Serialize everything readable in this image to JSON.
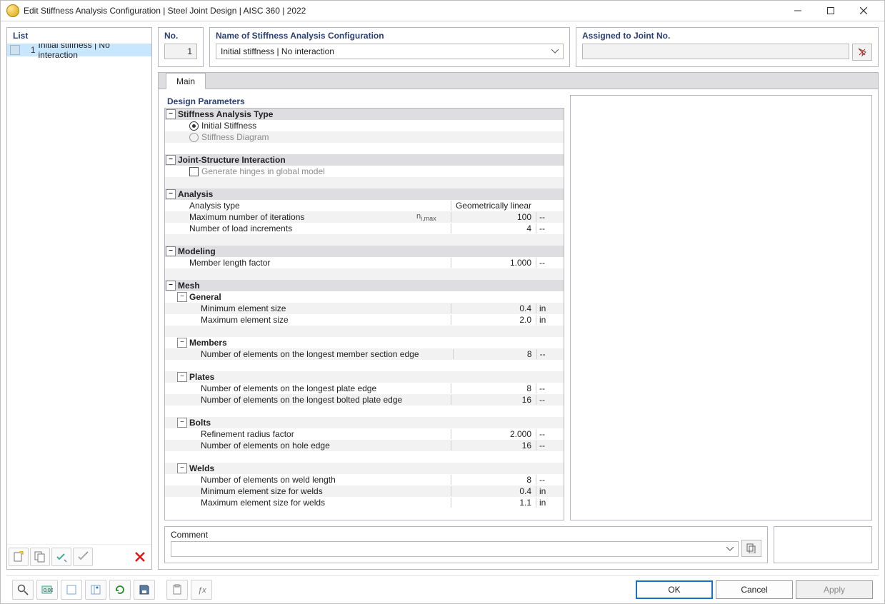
{
  "window": {
    "title": "Edit Stiffness Analysis Configuration | Steel Joint Design | AISC 360 | 2022"
  },
  "list": {
    "header": "List",
    "items": [
      {
        "num": "1",
        "label": "Initial stiffness | No interaction"
      }
    ]
  },
  "no": {
    "label": "No.",
    "value": "1"
  },
  "name": {
    "label": "Name of Stiffness Analysis Configuration",
    "value": "Initial stiffness | No interaction"
  },
  "assigned": {
    "label": "Assigned to Joint No.",
    "value": ""
  },
  "tabs": {
    "main": "Main"
  },
  "sectionTitle": "Design Parameters",
  "groups": {
    "sat": {
      "title": "Stiffness Analysis Type",
      "opt1": "Initial Stiffness",
      "opt2": "Stiffness Diagram"
    },
    "jsi": {
      "title": "Joint-Structure Interaction",
      "check": "Generate hinges in global model"
    },
    "analysis": {
      "title": "Analysis",
      "r1l": "Analysis type",
      "r1v": "Geometrically linear",
      "r2l": "Maximum number of iterations",
      "r2s": "ni,max",
      "r2v": "100",
      "r2u": "--",
      "r3l": "Number of load increments",
      "r3v": "4",
      "r3u": "--"
    },
    "modeling": {
      "title": "Modeling",
      "r1l": "Member length factor",
      "r1v": "1.000",
      "r1u": "--"
    },
    "mesh": {
      "title": "Mesh",
      "general": {
        "title": "General",
        "r1l": "Minimum element size",
        "r1v": "0.4",
        "r1u": "in",
        "r2l": "Maximum element size",
        "r2v": "2.0",
        "r2u": "in"
      },
      "members": {
        "title": "Members",
        "r1l": "Number of elements on the longest member section edge",
        "r1v": "8",
        "r1u": "--"
      },
      "plates": {
        "title": "Plates",
        "r1l": "Number of elements on the longest plate edge",
        "r1v": "8",
        "r1u": "--",
        "r2l": "Number of elements on the longest bolted plate edge",
        "r2v": "16",
        "r2u": "--"
      },
      "bolts": {
        "title": "Bolts",
        "r1l": "Refinement radius factor",
        "r1v": "2.000",
        "r1u": "--",
        "r2l": "Number of elements on hole edge",
        "r2v": "16",
        "r2u": "--"
      },
      "welds": {
        "title": "Welds",
        "r1l": "Number of elements on weld length",
        "r1v": "8",
        "r1u": "--",
        "r2l": "Minimum element size for welds",
        "r2v": "0.4",
        "r2u": "in",
        "r3l": "Maximum element size for welds",
        "r3v": "1.1",
        "r3u": "in"
      }
    }
  },
  "comment": {
    "label": "Comment",
    "value": ""
  },
  "buttons": {
    "ok": "OK",
    "cancel": "Cancel",
    "apply": "Apply"
  }
}
